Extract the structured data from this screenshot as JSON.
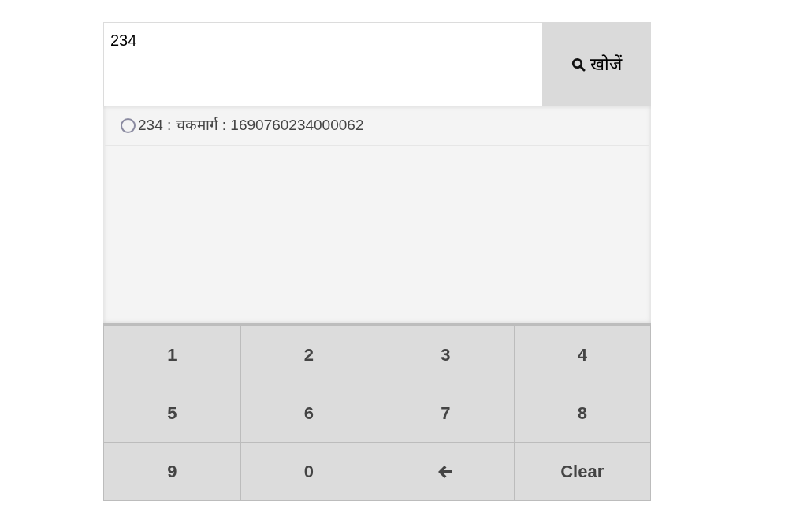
{
  "search": {
    "value": "234",
    "button": "खोजें"
  },
  "results": [
    {
      "label": "234 : चकमार्ग : 1690760234000062",
      "selected": false
    }
  ],
  "keypad": [
    {
      "kind": "key",
      "label": "1"
    },
    {
      "kind": "key",
      "label": "2"
    },
    {
      "kind": "key",
      "label": "3"
    },
    {
      "kind": "key",
      "label": "4"
    },
    {
      "kind": "key",
      "label": "5"
    },
    {
      "kind": "key",
      "label": "6"
    },
    {
      "kind": "key",
      "label": "7"
    },
    {
      "kind": "key",
      "label": "8"
    },
    {
      "kind": "key",
      "label": "9"
    },
    {
      "kind": "key",
      "label": "0"
    },
    {
      "kind": "backspace"
    },
    {
      "kind": "key",
      "label": "Clear"
    }
  ]
}
